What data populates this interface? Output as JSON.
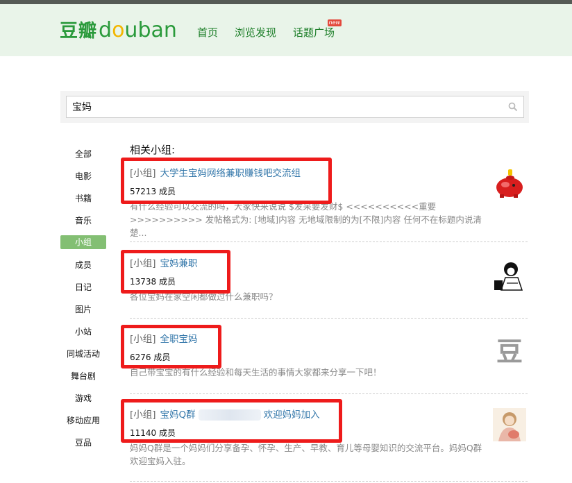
{
  "header": {
    "logo_cn": "豆瓣",
    "logo_en_1": "d",
    "logo_en_2": "o",
    "logo_en_3": "u",
    "logo_en_4": "ban",
    "nav": [
      "首页",
      "浏览发现",
      "话题广场"
    ],
    "new_badge": "new"
  },
  "search": {
    "value": "宝妈"
  },
  "sidebar": {
    "items": [
      "全部",
      "电影",
      "书籍",
      "音乐",
      "小组",
      "成员",
      "日记",
      "图片",
      "小站",
      "同城活动",
      "舞台剧",
      "游戏",
      "移动应用",
      "豆品"
    ],
    "active_index": 4
  },
  "results": {
    "title": "相关小组:",
    "items": [
      {
        "tag": "[小组]",
        "name": "大学生宝妈网络兼职赚钱吧交流组",
        "members": "57213 成员",
        "desc": "有什么经验可以交流的吗，大家快来说说 $发呆要发财$ <<<<<<<<<<重要>>>>>>>>>> 发帖格式为: [地域]内容 无地域限制的为[不限]内容 任何不在标题内说清楚..."
      },
      {
        "tag": "[小组]",
        "name": "宝妈兼职",
        "members": "13738 成员",
        "desc": "各位宝妈在家空闲都做过什么兼职吗？"
      },
      {
        "tag": "[小组]",
        "name": "全职宝妈",
        "members": "6276 成员",
        "desc": "自己带宝宝的有什么经验和每天生活的事情大家都来分享一下吧！"
      },
      {
        "tag": "[小组]",
        "name_a": "宝妈Q群",
        "name_b": "欢迎妈妈加入",
        "members": "11140 成员",
        "desc": "妈妈Q群是一个妈妈们分享备孕、怀孕、生产、早教、育儿等母婴知识的交流平台。妈妈Q群欢迎宝妈入驻。"
      }
    ],
    "placeholder_glyph": "豆"
  },
  "colors": {
    "brand_green": "#2a9a3b",
    "link_blue": "#3377aa",
    "highlight_red": "#ee1b1b",
    "active_tab": "#83bf73"
  }
}
